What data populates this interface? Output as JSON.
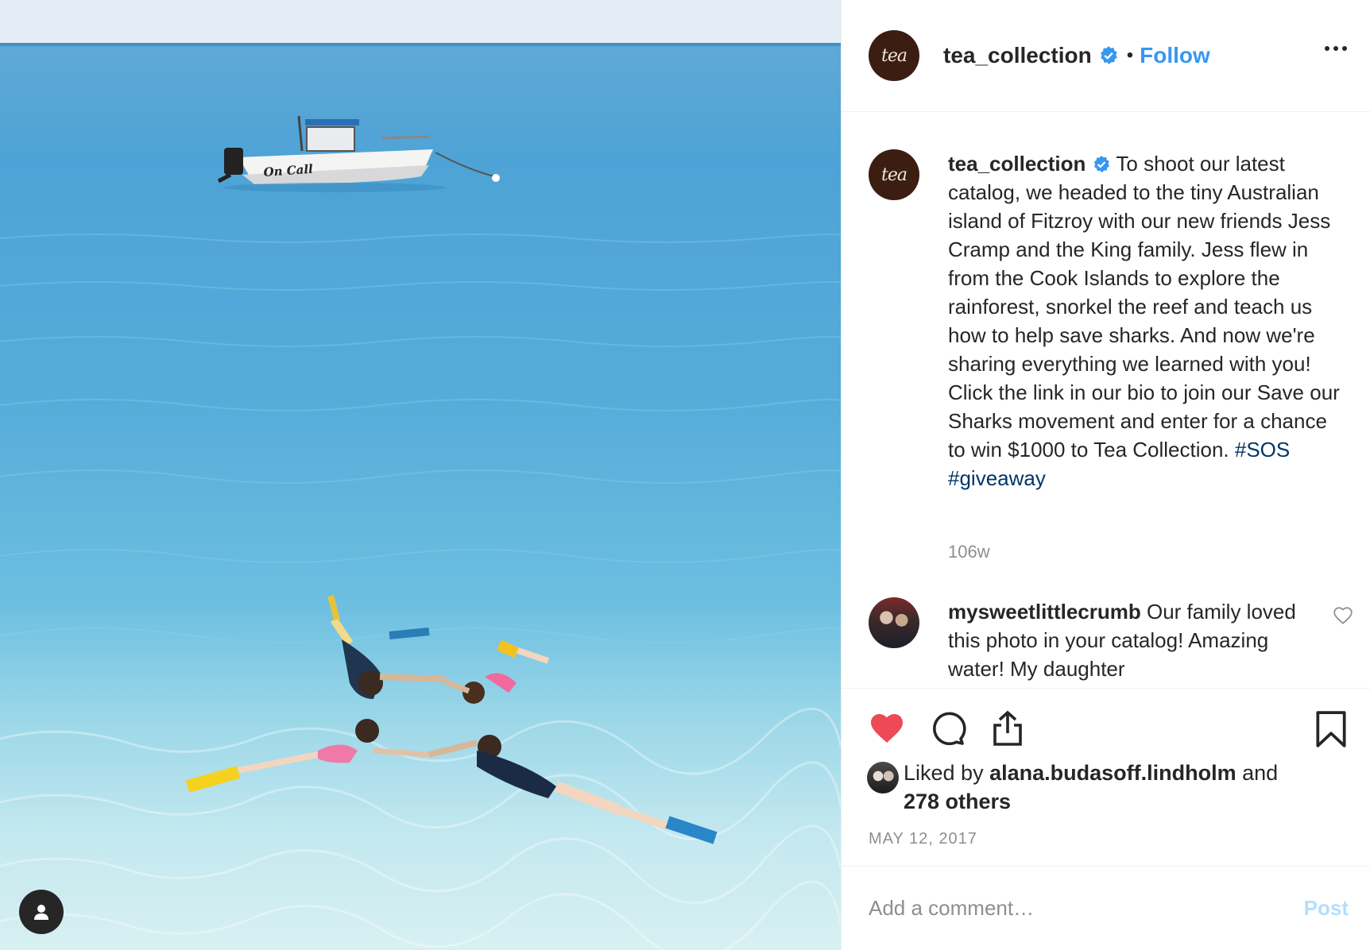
{
  "post": {
    "account": "tea_collection",
    "avatar_text": "tea",
    "follow_label": "Follow",
    "separator": "•"
  },
  "caption": {
    "username": "tea_collection",
    "text": "To shoot our latest catalog, we headed to the tiny Australian island of Fitzroy with our new friends Jess Cramp and the King family. Jess flew in from the Cook Islands to explore the rainforest, snorkel the reef and teach us how to help save sharks. And now we're sharing everything we learned with you! Click the link in our bio to join our Save our Sharks movement and enter for a chance to win $1000 to Tea Collection.",
    "hashtags": [
      "#SOS",
      "#giveaway"
    ],
    "age": "106w"
  },
  "comment": {
    "username": "mysweetlittlecrumb",
    "text": "Our family loved this photo in your catalog! Amazing water! My daughter"
  },
  "likes": {
    "prefix": "Liked by",
    "user": "alana.budasoff.lindholm",
    "suffix": "and",
    "others": "278 others"
  },
  "date": "MAY 12, 2017",
  "add_comment": {
    "placeholder": "Add a comment…",
    "post_label": "Post"
  },
  "photo": {
    "boat_text": "On Call"
  },
  "colors": {
    "accent": "#3897f0",
    "liked_heart": "#ed4956",
    "verified": "#3897f0",
    "hashtag": "#003569",
    "muted": "#8e8e8e"
  },
  "icons": [
    "user-tag-icon",
    "verified-icon",
    "more-options-icon",
    "like-heart-icon",
    "comment-icon",
    "share-icon",
    "bookmark-icon",
    "comment-like-icon"
  ]
}
